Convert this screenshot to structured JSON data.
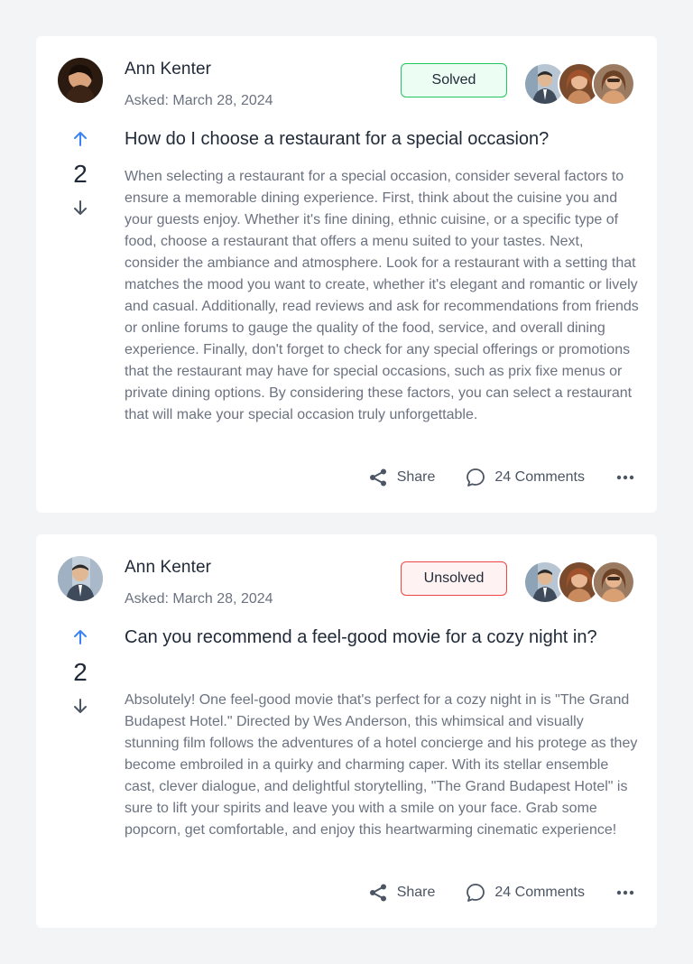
{
  "questions": [
    {
      "author": "Ann Kenter",
      "asked": "Asked: March 28, 2024",
      "status": "Solved",
      "votes": "2",
      "title": "How do I choose a restaurant for a special occasion?",
      "body": "When selecting a restaurant for a special occasion, consider several factors to ensure a memorable dining experience. First, think about the cuisine you and your guests enjoy. Whether it's fine dining, ethnic cuisine, or a specific type of food, choose a restaurant that offers a menu suited to your tastes. Next, consider the ambiance and atmosphere. Look for a restaurant with a setting that matches the mood you want to create, whether it's elegant and romantic or lively and casual. Additionally, read reviews and ask for recommendations from friends or online forums to gauge the quality of the food, service, and overall dining experience. Finally, don't forget to check for any special offerings or promotions that the restaurant may have for special occasions, such as prix fixe menus or private dining options. By considering these factors, you can select a restaurant that will make your special occasion truly unforgettable.",
      "share_label": "Share",
      "comments_label": "24 Comments"
    },
    {
      "author": "Ann Kenter",
      "asked": "Asked: March 28, 2024",
      "status": "Unsolved",
      "votes": "2",
      "title": "Can you recommend a feel-good movie for a cozy night in?",
      "body": "Absolutely! One feel-good movie that's perfect for a cozy night in is \"The Grand Budapest Hotel.\" Directed by Wes Anderson, this whimsical and visually stunning film follows the adventures of a hotel concierge and his protege as they become embroiled in a quirky and charming caper. With its stellar ensemble cast, clever dialogue, and delightful storytelling, \"The Grand Budapest Hotel\" is sure to lift your spirits and leave you with a smile on your face. Grab some popcorn, get comfortable, and enjoy this heartwarming cinematic experience!",
      "share_label": "Share",
      "comments_label": "24 Comments"
    }
  ],
  "colors": {
    "accent": "#3b82f6",
    "solved_border": "#22c55e",
    "solved_bg": "#ecfdf3",
    "unsolved_border": "#ef4444",
    "unsolved_bg": "#fef2f2"
  },
  "icons": {
    "vote_up": "arrow-up-icon",
    "vote_down": "arrow-down-icon",
    "share": "share-icon",
    "comments": "comment-icon",
    "more": "more-horizontal-icon"
  }
}
